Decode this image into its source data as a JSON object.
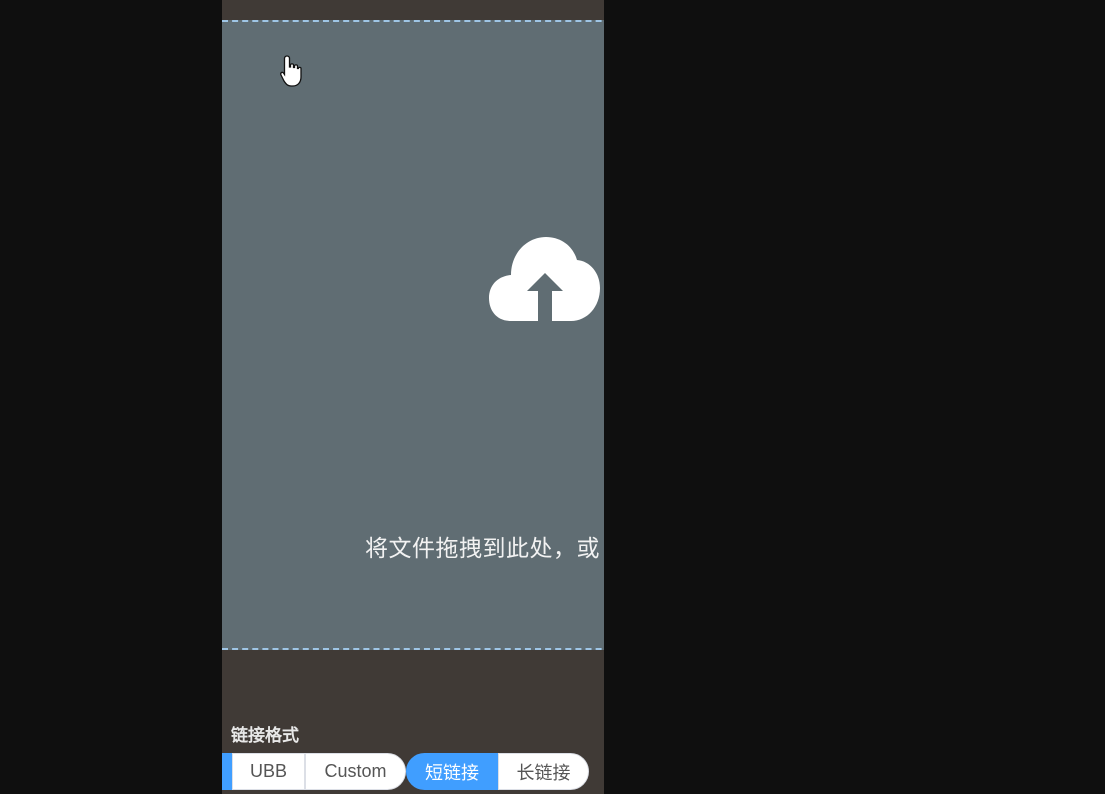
{
  "dropzone": {
    "text": "将文件拖拽到此处，或",
    "icon": "cloud-upload-icon"
  },
  "link_format": {
    "label": "链接格式",
    "format_options": [
      {
        "label": "",
        "active": true
      },
      {
        "label": "UBB",
        "active": false
      },
      {
        "label": "Custom",
        "active": false
      }
    ],
    "link_options": [
      {
        "label": "短链接",
        "active": true
      },
      {
        "label": "长链接",
        "active": false
      }
    ]
  },
  "colors": {
    "page_background": "#0f0f0f",
    "column_background": "#403a36",
    "dropzone_background": "#606d73",
    "dropzone_border": "#9fc6e6",
    "accent": "#409eff"
  }
}
